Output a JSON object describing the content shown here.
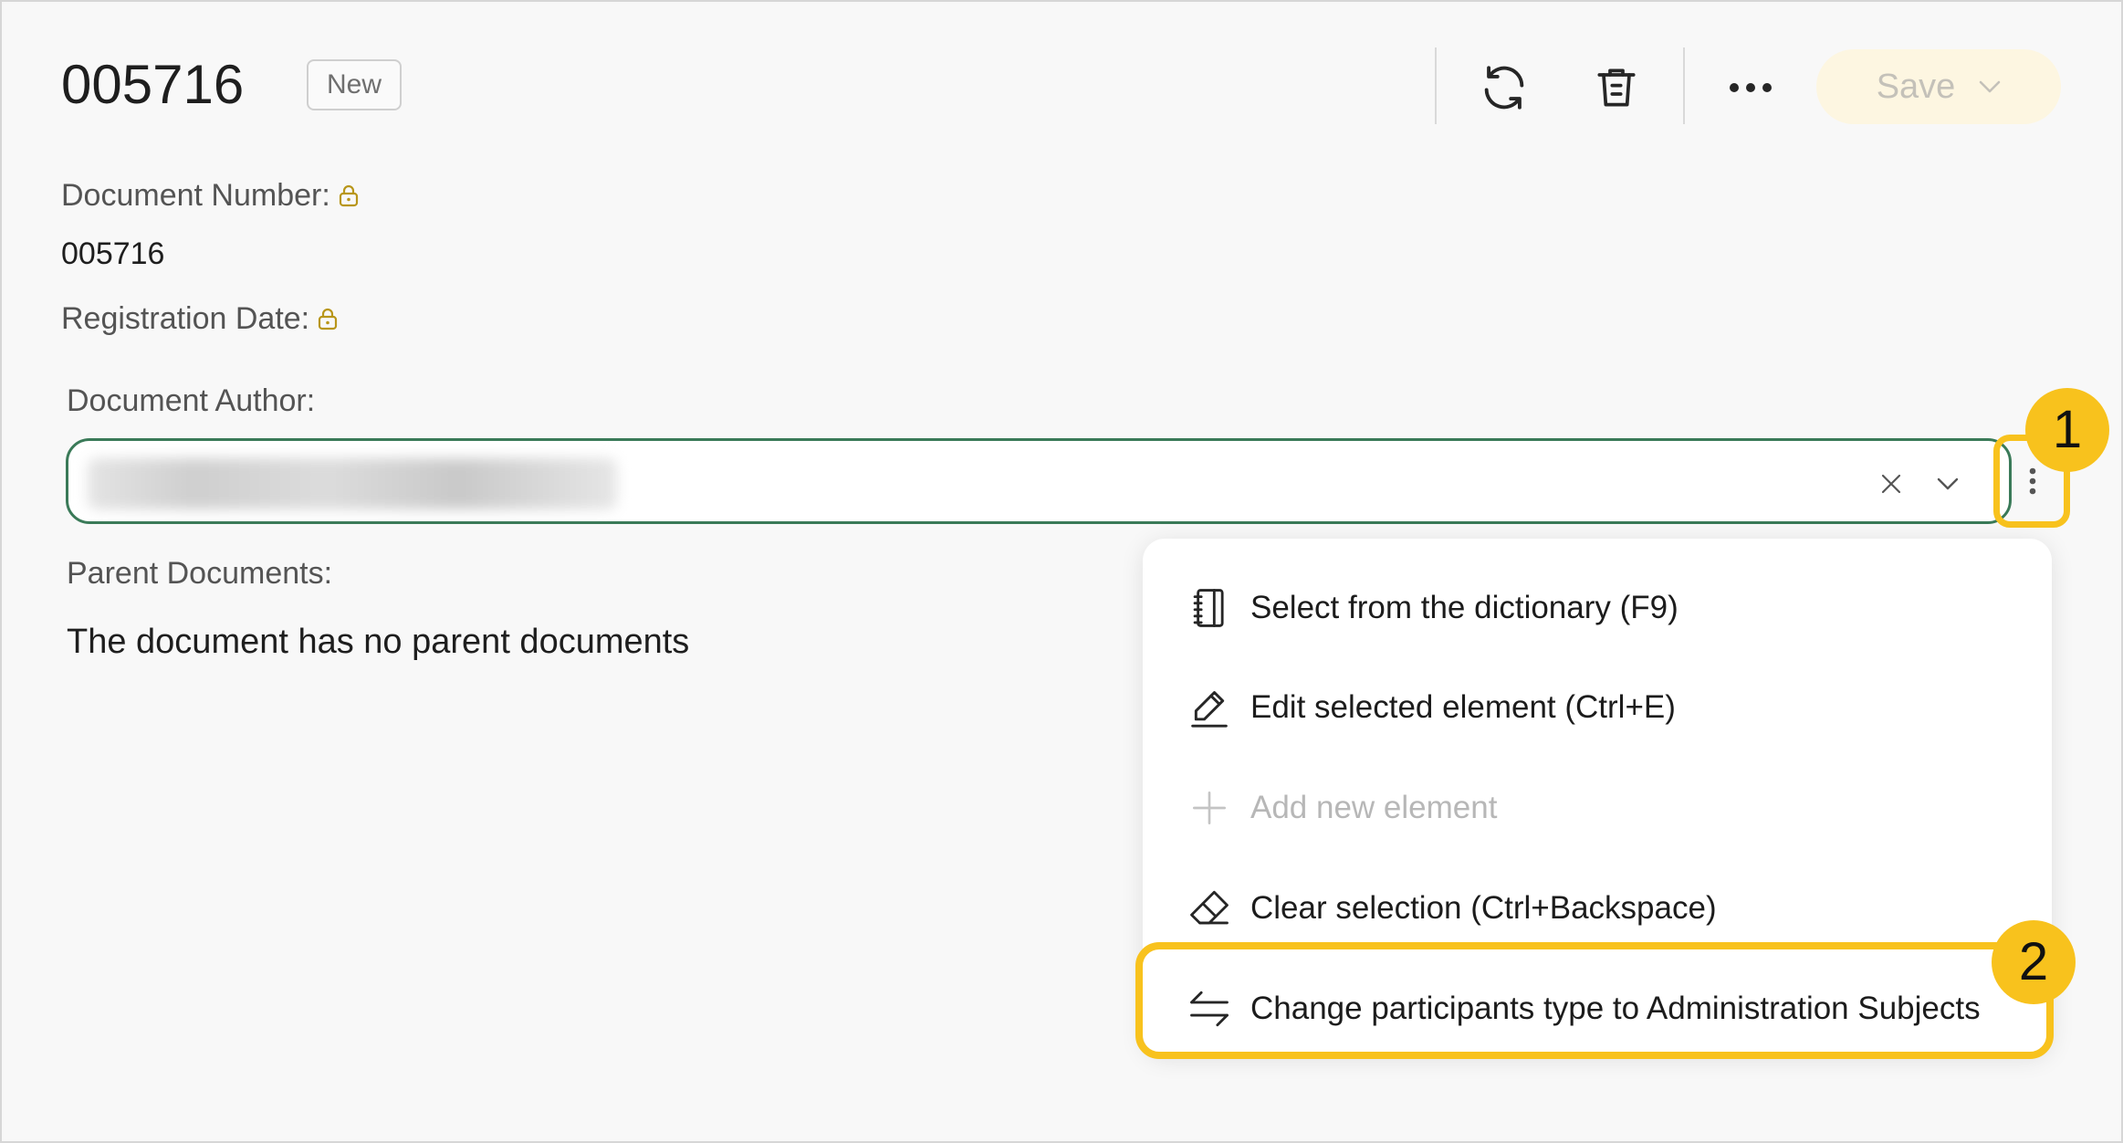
{
  "header": {
    "document_id": "005716",
    "status_badge": "New",
    "save_label": "Save"
  },
  "fields": {
    "document_number_label": "Document Number:",
    "document_number_value": "005716",
    "registration_date_label": "Registration Date:",
    "document_author_label": "Document Author:",
    "parent_documents_label": "Parent Documents:",
    "parent_documents_empty": "The document has no parent documents"
  },
  "context_menu": {
    "items": [
      {
        "label": "Select from the dictionary (F9)",
        "icon": "notebook-icon",
        "enabled": true
      },
      {
        "label": "Edit selected element (Ctrl+E)",
        "icon": "pencil-icon",
        "enabled": true
      },
      {
        "label": "Add new element",
        "icon": "plus-icon",
        "enabled": false
      },
      {
        "label": "Clear selection (Ctrl+Backspace)",
        "icon": "eraser-icon",
        "enabled": true
      },
      {
        "label": "Change participants type to Administration Subjects",
        "icon": "swap-arrows-icon",
        "enabled": true
      }
    ]
  },
  "callouts": [
    "1",
    "2"
  ],
  "colors": {
    "accent_yellow": "#f8c21d",
    "input_border_green": "#3a7a58",
    "save_button_bg": "#fdf6e1",
    "lock_icon": "#b8961a"
  }
}
